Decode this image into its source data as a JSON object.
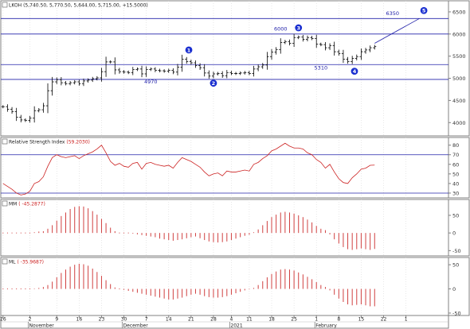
{
  "chart_data": [
    {
      "type": "ohlc",
      "legend": "LKOH (5,740.50, 5,770.50, 5,644.00, 5,715.00, +15.5000)",
      "ylim": [
        3700,
        6750
      ],
      "yticks": [
        "4000",
        "4500",
        "5000",
        "5500",
        "6000",
        "6500"
      ],
      "hlines": [
        4975,
        5310,
        6000,
        6350
      ],
      "annotations": [
        {
          "text": "4970",
          "x": 33,
          "y": 4880
        },
        {
          "text": "6000",
          "x": 62,
          "y": 6080
        },
        {
          "text": "5310",
          "x": 71,
          "y": 5195
        },
        {
          "text": "6350",
          "x": 87,
          "y": 6430
        }
      ],
      "wave_labels": [
        {
          "text": "1",
          "x": 41.5,
          "y": 5640
        },
        {
          "text": "2",
          "x": 47,
          "y": 4890
        },
        {
          "text": "3",
          "x": 66,
          "y": 6140
        },
        {
          "text": "4",
          "x": 78.5,
          "y": 5160
        },
        {
          "text": "5",
          "x": 94,
          "y": 6530
        }
      ],
      "trendline": {
        "x": [
          83,
          93
        ],
        "y": [
          5790,
          6350
        ]
      },
      "closes": [
        4360,
        4300,
        4250,
        4120,
        4060,
        4050,
        4100,
        4270,
        4290,
        4380,
        4720,
        4920,
        4970,
        4900,
        4880,
        4900,
        4920,
        4880,
        4940,
        4960,
        4990,
        5010,
        5150,
        5370,
        5370,
        5190,
        5150,
        5140,
        5130,
        5200,
        5210,
        5100,
        5200,
        5210,
        5180,
        5170,
        5160,
        5180,
        5140,
        5250,
        5430,
        5380,
        5350,
        5290,
        5240,
        5120,
        5050,
        5100,
        5110,
        5060,
        5130,
        5110,
        5110,
        5120,
        5130,
        5110,
        5210,
        5260,
        5300,
        5490,
        5590,
        5650,
        5810,
        5830,
        5790,
        5920,
        5930,
        5880,
        5920,
        5900,
        5770,
        5760,
        5690,
        5740,
        5600,
        5560,
        5430,
        5380,
        5450,
        5490,
        5600,
        5640,
        5690,
        5715
      ]
    },
    {
      "type": "line",
      "legend": "Relative Strength Index (59.2030)",
      "ylim": [
        25,
        88
      ],
      "yticks": [
        "30",
        "40",
        "50",
        "60",
        "70",
        "80"
      ],
      "hlines": [
        30,
        70
      ],
      "values": [
        40,
        37,
        34,
        30,
        28,
        29,
        32,
        40,
        42,
        47,
        58,
        67,
        70,
        68,
        67,
        68,
        69,
        66,
        69,
        71,
        73,
        76,
        80,
        72,
        63,
        59,
        61,
        58,
        57,
        61,
        62,
        55,
        61,
        62,
        60,
        59,
        58,
        59,
        56,
        62,
        67,
        65,
        63,
        60,
        57,
        52,
        48,
        50,
        51,
        48,
        53,
        52,
        52,
        53,
        54,
        53,
        60,
        62,
        66,
        69,
        74,
        76,
        79,
        82,
        79,
        77,
        77,
        76,
        72,
        70,
        65,
        62,
        56,
        60,
        52,
        45,
        41,
        40,
        46,
        50,
        55,
        56,
        59,
        59.2
      ]
    },
    {
      "type": "bar",
      "legend": "MM ( -45.2877)",
      "ylim": [
        -65,
        95
      ],
      "yticks": [
        "50",
        "0",
        "-50"
      ],
      "values": [
        0,
        0,
        0,
        0,
        0,
        0,
        0,
        2,
        4,
        5,
        12,
        22,
        35,
        48,
        58,
        68,
        74,
        76,
        75,
        70,
        62,
        52,
        40,
        28,
        15,
        5,
        0,
        0,
        0,
        -2,
        -4,
        -6,
        -8,
        -10,
        -12,
        -16,
        -18,
        -20,
        -22,
        -20,
        -18,
        -15,
        -12,
        -10,
        -15,
        -20,
        -24,
        -26,
        -27,
        -26,
        -24,
        -20,
        -16,
        -12,
        -8,
        -5,
        2,
        10,
        22,
        34,
        45,
        52,
        58,
        60,
        58,
        55,
        50,
        45,
        38,
        30,
        20,
        12,
        8,
        -4,
        -18,
        -30,
        -40,
        -46,
        -48,
        -46,
        -44,
        -46,
        -48,
        -45.3
      ]
    },
    {
      "type": "bar",
      "legend": "ML ( -35.9687)",
      "ylim": [
        -55,
        65
      ],
      "yticks": [
        "50",
        "0",
        "-50"
      ],
      "values": [
        0,
        0,
        0,
        0,
        0,
        0,
        0,
        1,
        2,
        4,
        8,
        15,
        24,
        33,
        40,
        46,
        50,
        52,
        51,
        48,
        42,
        35,
        27,
        18,
        10,
        3,
        0,
        -2,
        -4,
        -6,
        -8,
        -10,
        -12,
        -14,
        -16,
        -18,
        -20,
        -22,
        -22,
        -20,
        -18,
        -15,
        -12,
        -10,
        -12,
        -15,
        -17,
        -18,
        -18,
        -17,
        -15,
        -12,
        -9,
        -6,
        -3,
        -1,
        2,
        8,
        16,
        24,
        31,
        36,
        40,
        41,
        40,
        38,
        34,
        30,
        25,
        20,
        14,
        8,
        4,
        -3,
        -12,
        -20,
        -27,
        -32,
        -34,
        -33,
        -32,
        -34,
        -36,
        -36
      ]
    }
  ],
  "time_axis": {
    "ticks": [
      {
        "label": "26",
        "x": 0
      },
      {
        "label": "2",
        "x": 6
      },
      {
        "label": "9",
        "x": 12
      },
      {
        "label": "16",
        "x": 17
      },
      {
        "label": "23",
        "x": 22
      },
      {
        "label": "30",
        "x": 27
      },
      {
        "label": "7",
        "x": 32
      },
      {
        "label": "14",
        "x": 37
      },
      {
        "label": "21",
        "x": 42
      },
      {
        "label": "28",
        "x": 47
      },
      {
        "label": "4",
        "x": 51
      },
      {
        "label": "11",
        "x": 55
      },
      {
        "label": "18",
        "x": 60
      },
      {
        "label": "25",
        "x": 65
      },
      {
        "label": "1",
        "x": 70
      },
      {
        "label": "8",
        "x": 75
      },
      {
        "label": "15",
        "x": 80
      },
      {
        "label": "22",
        "x": 85
      },
      {
        "label": "1",
        "x": 90
      }
    ],
    "months": [
      {
        "label": "November",
        "x": 6
      },
      {
        "label": "December",
        "x": 27
      },
      {
        "label": "2021",
        "x": 51
      },
      {
        "label": "February",
        "x": 70
      }
    ]
  },
  "colors": {
    "price": "#000000",
    "rsi": "#cc2222",
    "hist": "#d04040",
    "guide": "#2222aa",
    "label": "#2222aa"
  }
}
